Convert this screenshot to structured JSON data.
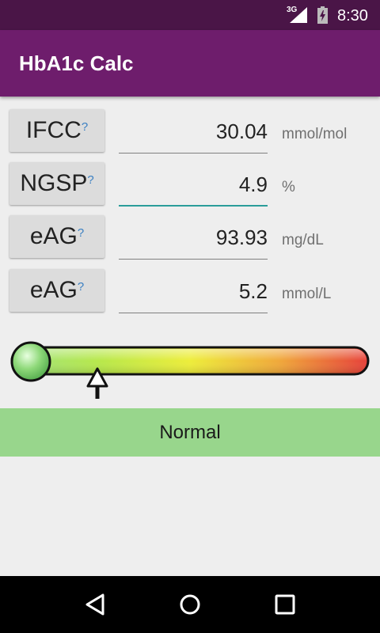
{
  "status_bar": {
    "network": "3G",
    "time": "8:30",
    "icons": [
      "signal-icon",
      "battery-charging-icon"
    ]
  },
  "app_bar": {
    "title": "HbA1c Calc"
  },
  "rows": [
    {
      "unit_button": "IFCC",
      "help": "?",
      "value": "30.04",
      "unit": "mmol/mol",
      "focused": false
    },
    {
      "unit_button": "NGSP",
      "help": "?",
      "value": "4.9",
      "unit": "%",
      "focused": true
    },
    {
      "unit_button": "eAG",
      "help": "?",
      "value": "93.93",
      "unit": "mg/dL",
      "focused": false
    },
    {
      "unit_button": "eAG",
      "help": "?",
      "value": "5.2",
      "unit": "mmol/L",
      "focused": false
    }
  ],
  "gauge": {
    "indicator_level": 0.24,
    "knob_icon": "green-knob-icon",
    "pointer_icon": "arrow-up-icon",
    "gradient_colors": [
      "#9ee27f",
      "#b8e84a",
      "#eded3a",
      "#f0a83a",
      "#e6403a"
    ]
  },
  "status": {
    "label": "Normal",
    "color": "#98d68c"
  },
  "nav_bar": {
    "icons": [
      "back-icon",
      "home-icon",
      "recents-icon"
    ]
  },
  "colors": {
    "status_bar": "#4a1547",
    "app_bar": "#6e1d6c",
    "focus_accent": "#2a9d9a",
    "help_mark": "#3a7fc2"
  }
}
